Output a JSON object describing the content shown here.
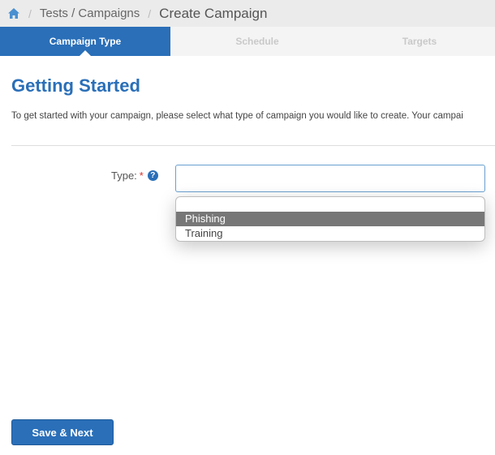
{
  "breadcrumb": {
    "icon": "home-icon",
    "link": "Tests / Campaigns",
    "current": "Create Campaign"
  },
  "steps": [
    {
      "label": "Campaign Type",
      "active": true
    },
    {
      "label": "Schedule",
      "active": false
    },
    {
      "label": "Targets",
      "active": false
    }
  ],
  "heading": "Getting Started",
  "intro": "To get started with your campaign, please select what type of campaign you would like to create. Your campai",
  "form": {
    "type_label": "Type:",
    "required_mark": "*",
    "help_icon": "?",
    "type_value": "",
    "options": [
      "",
      "Phishing",
      "Training"
    ],
    "highlighted_option": "Phishing"
  },
  "buttons": {
    "save_next": "Save & Next"
  },
  "colors": {
    "accent": "#2a6fb8",
    "required": "#d9322b",
    "highlight": "#777777"
  }
}
